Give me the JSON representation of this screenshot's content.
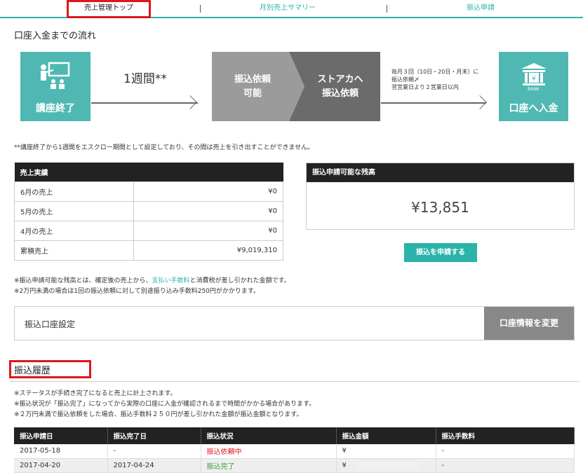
{
  "nav": {
    "tabs": [
      {
        "label": "売上管理トップ"
      },
      {
        "label": "月別売上サマリー"
      },
      {
        "label": "振込申請"
      }
    ]
  },
  "flow": {
    "section_title": "口座入金までの流れ",
    "course_end_label": "講座終了",
    "one_week_label": "1週間**",
    "request_enabled_line1": "振込依頼",
    "request_enabled_line2": "可能",
    "to_store_line1": "ストアカへ",
    "to_store_line2": "振込依頼",
    "schedule_line1": "毎月３回（10日・20日・月末）に",
    "schedule_line2": "振込依頼〆",
    "schedule_line3": "翌営業日より２営業日以内",
    "bank_icon_text": "BANK",
    "deposit_label": "口座へ入金",
    "colors": {
      "teal": "#4fb8b3",
      "gray1": "#9b9b9b",
      "gray2": "#6b6b6b"
    }
  },
  "escrow_note": "**講座終了から1週間をエスクロー期間として設定しており、その間は売上を引き出すことができません。",
  "sales": {
    "header": "売上実績",
    "rows": [
      {
        "label": "6月の売上",
        "value": "¥0"
      },
      {
        "label": "5月の売上",
        "value": "¥0"
      },
      {
        "label": "4月の売上",
        "value": "¥0"
      },
      {
        "label": "累積売上",
        "value": "¥9,019,310"
      }
    ]
  },
  "balance": {
    "header": "振込申請可能な残高",
    "amount": "¥13,851",
    "apply_button": "振込を申請する"
  },
  "notes": {
    "line1_pre": "※振込申請可能な残高とは、確定後の売上から、",
    "line1_link": "支払い手数料",
    "line1_post": "と消費税が差し引かれた金額です。",
    "line2": "※2万円未満の場合は1回の振込依頼に対して別途振り込み手数料250円がかかります。"
  },
  "bank_settings": {
    "label": "振込口座設定",
    "change_button": "口座情報を変更"
  },
  "history": {
    "title": "振込履歴",
    "note1": "※ステータスが手続き完了になると売上に計上されます。",
    "note2": "※振込状況が「振込完了」になってから実際の口座に入金が確認されるまで時間がかかる場合があります。",
    "note3": "※２万円未満で振込依頼をした場合、振込手数料２５０円が差し引かれた金額が振込金額となります。",
    "columns": [
      "振込申請日",
      "振込完了日",
      "振込状況",
      "振込金額",
      "振込手数料"
    ],
    "rows": [
      {
        "applied": "2017-05-18",
        "completed": "-",
        "status": "振込依頼中",
        "amount": "¥",
        "fee": "-"
      },
      {
        "applied": "2017-04-20",
        "completed": "2017-04-24",
        "status": "振込完了",
        "amount": "¥",
        "fee": "-"
      }
    ]
  }
}
